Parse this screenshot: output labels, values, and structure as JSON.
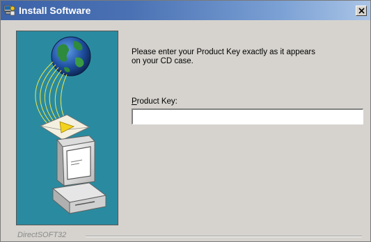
{
  "window": {
    "title": "Install Software",
    "icon": "install-software-icon",
    "close_icon": "close-icon"
  },
  "side_art": {
    "icons": [
      "globe-icon",
      "envelope-icon",
      "computer-icon"
    ]
  },
  "main": {
    "instruction_line1": "Please enter your Product Key exactly as it appears",
    "instruction_line2": "on your CD case.",
    "product_key_label_first": "P",
    "product_key_label_rest": "roduct Key:",
    "product_key_value": "",
    "product_key_placeholder": ""
  },
  "footer": {
    "brand": "DirectSOFT32"
  },
  "colors": {
    "titlebar": "#3c63a8",
    "dialog_bg": "#d6d3ce",
    "side_panel": "#2a8ba0"
  }
}
